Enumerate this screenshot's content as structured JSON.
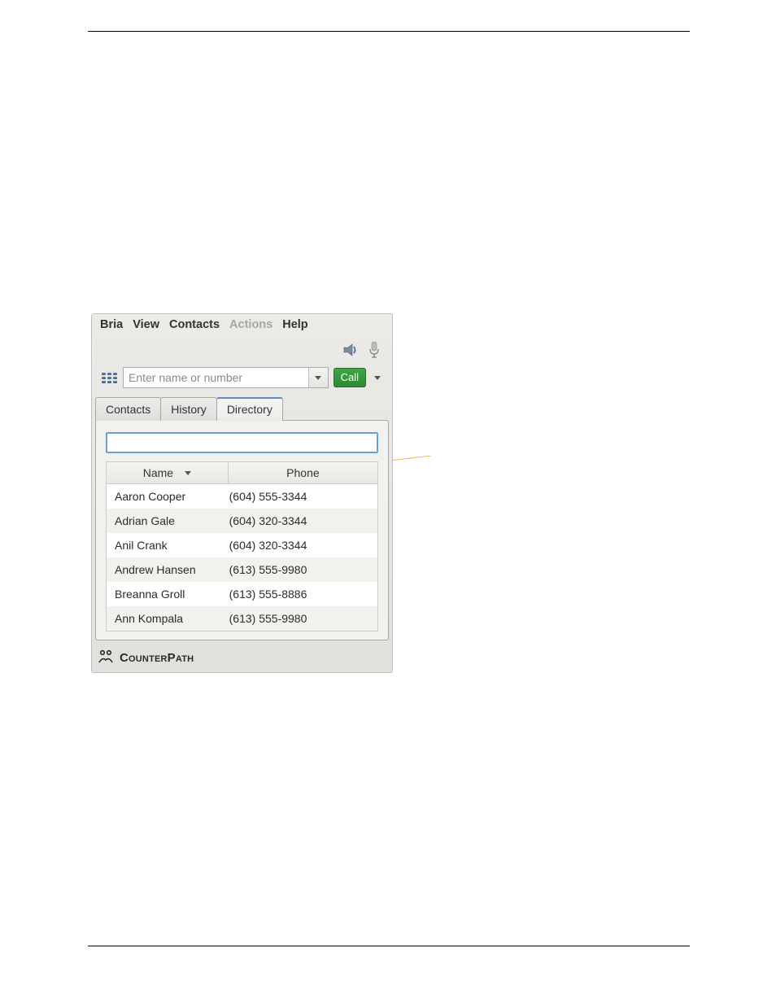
{
  "menu": {
    "items": [
      "Bria",
      "View",
      "Contacts",
      "Actions",
      "Help"
    ],
    "disabled_index": 3
  },
  "input": {
    "placeholder": "Enter name or number",
    "call_label": "Call"
  },
  "tabs": {
    "items": [
      "Contacts",
      "History",
      "Directory"
    ],
    "active_index": 2
  },
  "directory": {
    "search_value": "",
    "columns": {
      "name": "Name",
      "phone": "Phone"
    },
    "rows": [
      {
        "name": "Aaron Cooper",
        "phone": "(604) 555-3344"
      },
      {
        "name": "Adrian Gale",
        "phone": "(604) 320-3344"
      },
      {
        "name": "Anil Crank",
        "phone": "(604) 320-3344"
      },
      {
        "name": "Andrew Hansen",
        "phone": "(613) 555-9980"
      },
      {
        "name": "Breanna Groll",
        "phone": "(613) 555-8886"
      },
      {
        "name": "Ann Kompala",
        "phone": "(613) 555-9980"
      }
    ]
  },
  "footer": {
    "brand": "CounterPath"
  }
}
